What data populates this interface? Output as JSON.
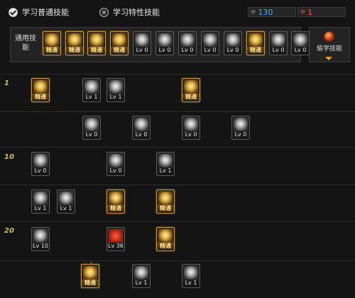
{
  "tabs": [
    {
      "label": "学习普通技能",
      "selected": true
    },
    {
      "label": "学习特性技能",
      "selected": false
    }
  ],
  "counters": {
    "sp": {
      "tag": "SP",
      "value": "130",
      "color": "#5aa0ff"
    },
    "tp": {
      "tag": "TP",
      "value": "1",
      "color": "#ff5a3a"
    }
  },
  "common": {
    "label": "通用技能",
    "skills": [
      {
        "icon": "bow-icon",
        "label": "精通",
        "gold": true
      },
      {
        "icon": "flame-dancer-icon",
        "label": "精通",
        "gold": true
      },
      {
        "icon": "leaping-figure-icon",
        "label": "精通",
        "gold": true
      },
      {
        "icon": "running-figure-icon",
        "label": "精通",
        "gold": true
      },
      {
        "icon": "wings-icon",
        "label": "Lv 0",
        "gold": false
      },
      {
        "icon": "target-icon",
        "label": "Lv 0",
        "gold": false
      },
      {
        "icon": "crosshair-icon",
        "label": "Lv 0",
        "gold": false
      },
      {
        "icon": "pyramid-icon",
        "label": "Lv 0",
        "gold": false
      },
      {
        "icon": "mountain-icon",
        "label": "Lv 0",
        "gold": false
      },
      {
        "icon": "spiral-icon",
        "label": "精通",
        "gold": true
      },
      {
        "icon": "strongman-icon",
        "label": "Lv 0",
        "gold": false
      },
      {
        "icon": "figure-icon",
        "label": "Lv 0",
        "gold": false
      }
    ]
  },
  "steal": {
    "label": "偷学技能",
    "icon": "orb-icon"
  },
  "levels": [
    "1",
    "10",
    "20"
  ],
  "tree": [
    {
      "icon": "scroll-icon",
      "label": "精通",
      "gold": true
    },
    {
      "icon": "slash-arc-icon",
      "label": "Lv 1",
      "gold": false
    },
    {
      "icon": "slash-curve-icon",
      "label": "Lv 1",
      "gold": false
    },
    {
      "icon": "leaf-burst-icon",
      "label": "精通",
      "gold": true
    },
    {
      "icon": "burst-icon",
      "label": "Lv 0",
      "gold": false
    },
    {
      "icon": "triple-arrow-icon",
      "label": "Lv 0",
      "gold": false
    },
    {
      "icon": "wave-icon",
      "label": "Lv 0",
      "gold": false
    },
    {
      "icon": "shield-icon",
      "label": "Lv 0",
      "gold": false
    },
    {
      "icon": "swift-slash-icon",
      "label": "Lv 0",
      "gold": false
    },
    {
      "icon": "crescent-icon",
      "label": "Lv 0",
      "gold": false
    },
    {
      "icon": "whirl-icon",
      "label": "Lv 1",
      "gold": false
    },
    {
      "icon": "lunge-icon",
      "label": "Lv 1",
      "gold": false
    },
    {
      "icon": "dash-icon",
      "label": "Lv 1",
      "gold": false
    },
    {
      "icon": "claw-icon",
      "label": "精通",
      "gold": true
    },
    {
      "icon": "green-crest-icon",
      "label": "精通",
      "gold": true
    },
    {
      "icon": "flame-pillar-icon",
      "label": "Lv 10",
      "gold": false
    },
    {
      "icon": "red-vortex-icon",
      "label": "Lv 36",
      "gold": false
    },
    {
      "icon": "meditation-icon",
      "label": "精通",
      "gold": true
    },
    {
      "icon": "kneel-slash-icon",
      "label": "精通",
      "gold": true
    },
    {
      "icon": "eye-icon",
      "label": "Lv 1",
      "gold": false
    },
    {
      "icon": "archer-icon",
      "label": "Lv 1",
      "gold": false
    }
  ]
}
